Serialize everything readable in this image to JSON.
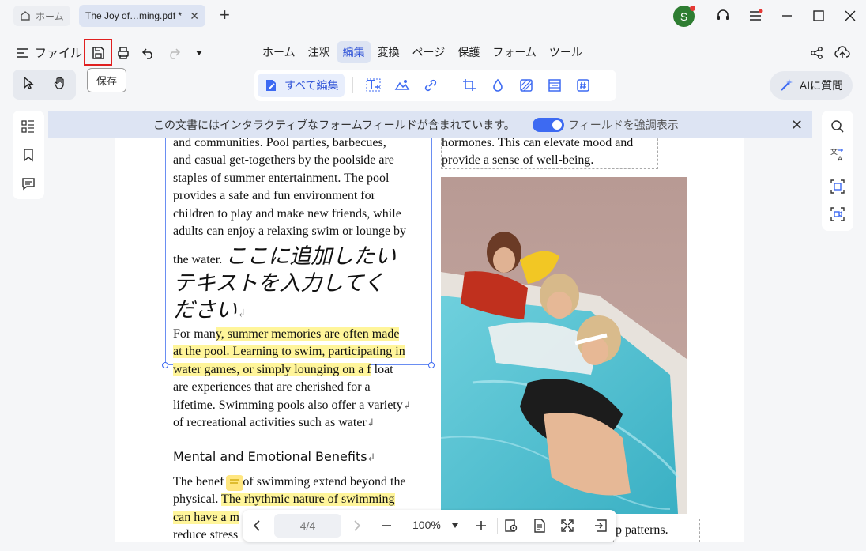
{
  "titlebar": {
    "home_tab": "ホーム",
    "doc_tab": "The Joy of…ming.pdf *",
    "avatar_letter": "S"
  },
  "menu": {
    "file_label": "ファイル",
    "tabs": [
      "ホーム",
      "注釈",
      "編集",
      "変換",
      "ページ",
      "保護",
      "フォーム",
      "ツール"
    ],
    "active_tab": "編集"
  },
  "tooltip": "保存",
  "edit_toolbar": {
    "edit_all_label": "すべて編集"
  },
  "ai_button": "AIに質問",
  "banner": {
    "message": "この文書にはインタラクティブなフォームフィールドが含まれています。",
    "toggle_label": "フィールドを強調表示"
  },
  "document": {
    "left_col_lines": [
      "and communities. Pool parties, barbecues,",
      "and casual get-togethers by the poolside are",
      "staples of summer entertainment. The pool",
      "provides a safe and fun environment for",
      "children to play and make new friends, while",
      "adults can enjoy a relaxing swim or lounge by"
    ],
    "the_water": "the water.",
    "jp_line1": "ここに追加したい",
    "jp_line2": "テキストを入力してく",
    "jp_line3": "ださい",
    "para2_start": "For man",
    "para2_hl1": "y, summer memories are often made",
    "para2_hl2": "at the pool. Learning to swim, participating in",
    "para2_hl3": "water games, or simply lounging on a f",
    "para2_rest1": "loat",
    "para2_lines": [
      "are experiences that are cherished for a",
      "lifetime. Swimming pools also offer a variety",
      "of recreational activities such as water"
    ],
    "heading": "Mental and Emotional Benefits",
    "para3_a": "The benef",
    "para3_b": "of swimming extend beyond the",
    "para3_c": "physical.",
    "para3_hl": "The rhythmic nature of swimming",
    "para3_hl2": "can have a m",
    "para3_last": "reduce stress",
    "right_lines": [
      "hormones. This can elevate mood and",
      "provide a sense of well-being."
    ],
    "right_bottom": "p patterns."
  },
  "navbar": {
    "page_indicator": "4/4",
    "zoom": "100%"
  },
  "colors": {
    "accent": "#3d6af2",
    "highlight": "#fff59a",
    "save_outline": "#e02020"
  }
}
